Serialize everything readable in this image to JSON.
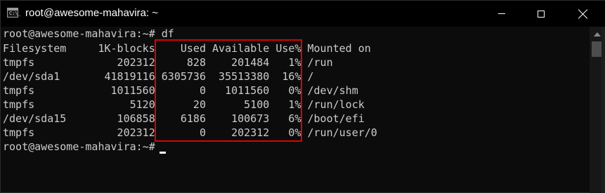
{
  "window": {
    "title": "root@awesome-mahavira: ~",
    "icon": "terminal-icon",
    "icon_glyph": "C:\\_"
  },
  "terminal": {
    "lines": [
      "root@awesome-mahavira:~# df",
      "Filesystem     1K-blocks    Used Available Use% Mounted on",
      "tmpfs             202312     828    201484   1% /run",
      "/dev/sda1       41819116 6305736  35513380  16% /",
      "tmpfs            1011560       0   1011560   0% /dev/shm",
      "tmpfs               5120      20      5100   1% /run/lock",
      "/dev/sda15        106858    6186    100673   6% /boot/efi",
      "tmpfs             202312       0    202312   0% /run/user/0",
      "root@awesome-mahavira:~# "
    ]
  },
  "colors": {
    "background": "#0c0c0c",
    "text": "#cccccc",
    "highlight_border": "#e00000"
  }
}
